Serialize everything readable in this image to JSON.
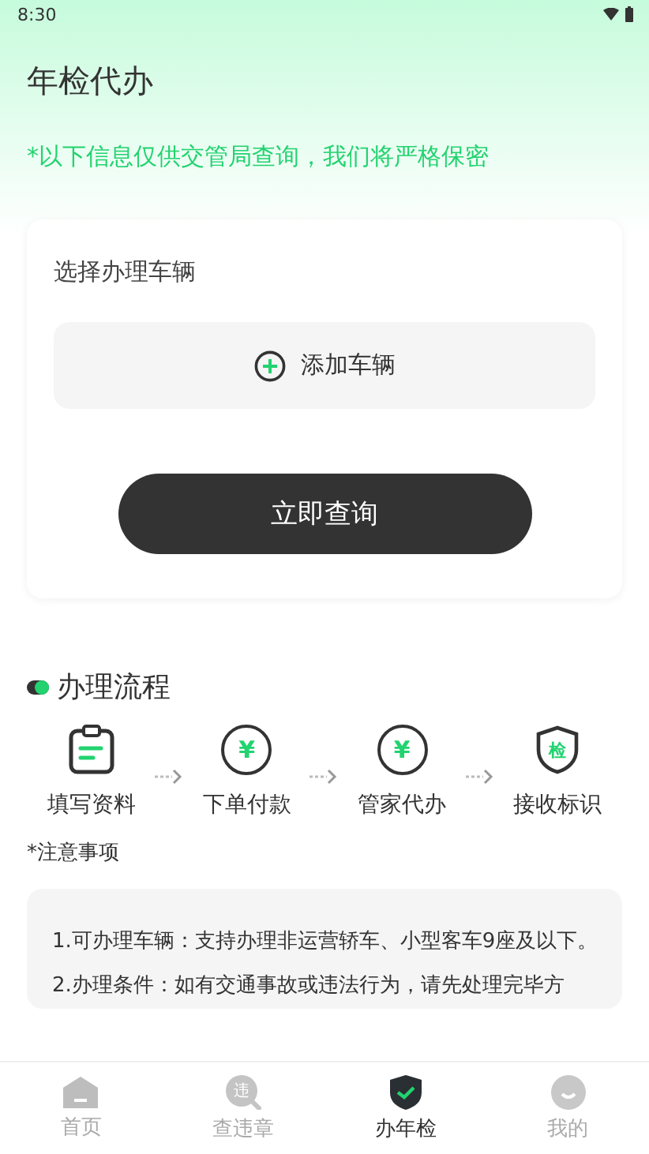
{
  "status_bar": {
    "time": "8:30"
  },
  "title": "年检代办",
  "notice": "*以下信息仅供交管局查询，我们将严格保密",
  "vehicle_card": {
    "label": "选择办理车辆",
    "add_button": "添加车辆",
    "submit_button": "立即查询"
  },
  "process": {
    "title": "办理流程",
    "steps": [
      {
        "kind": "clipboard",
        "label": "填写资料"
      },
      {
        "kind": "coin",
        "glyph": "¥",
        "label": "下单付款"
      },
      {
        "kind": "coin",
        "glyph": "¥",
        "label": "管家代办"
      },
      {
        "kind": "shield",
        "glyph": "检",
        "label": "接收标识"
      }
    ]
  },
  "notes": {
    "title": "*注意事项",
    "items": [
      "1.可办理车辆：支持办理非运营轿车、小型客车9座及以下。",
      "2.办理条件：如有交通事故或违法行为，请先处理完毕方"
    ]
  },
  "tab_bar": [
    {
      "kind": "home",
      "label": "首页",
      "selected": false
    },
    {
      "kind": "violation",
      "glyph": "违",
      "label": "查违章",
      "selected": false
    },
    {
      "kind": "inspection",
      "label": "办年检",
      "selected": true
    },
    {
      "kind": "profile",
      "label": "我的",
      "selected": false
    }
  ]
}
